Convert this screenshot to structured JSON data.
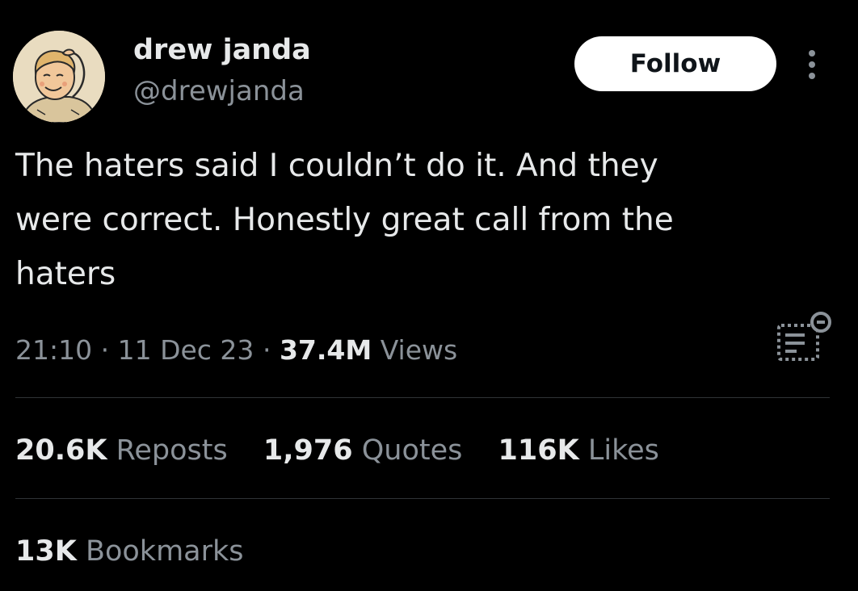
{
  "author": {
    "display_name": "drew janda",
    "handle": "@drewjanda",
    "avatar_icon": "cartoon-boy-scratching-head"
  },
  "follow_label": "Follow",
  "more_icon": "more-vertical-icon",
  "tweet": {
    "text": "The haters said I couldn’t do it. And they\nwere correct. Honestly great call from the\nhaters"
  },
  "meta": {
    "time": "21:10",
    "separator": "·",
    "date": "11 Dec 23",
    "views_count": "37.4M",
    "views_label": "Views"
  },
  "analytics_icon": "post-analytics-icon",
  "stats": {
    "reposts_count": "20.6K",
    "reposts_label": "Reposts",
    "quotes_count": "1,976",
    "quotes_label": "Quotes",
    "likes_count": "116K",
    "likes_label": "Likes",
    "bookmarks_count": "13K",
    "bookmarks_label": "Bookmarks"
  },
  "colors": {
    "background": "#000000",
    "primary_text": "#e7e9ea",
    "secondary_text": "#8b9299",
    "divider": "#2f3336",
    "follow_bg": "#ffffff"
  }
}
